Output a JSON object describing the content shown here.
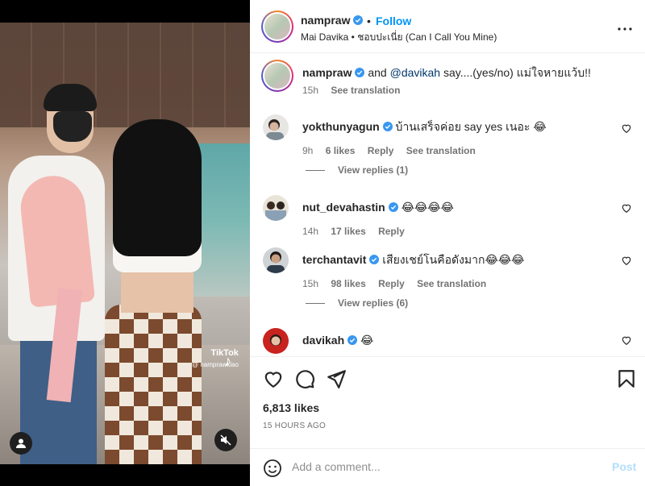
{
  "header": {
    "username": "nampraw",
    "follow_label": "Follow",
    "separator": "•",
    "subtitle": "Mai Davika • ชอบปะเนี่ย (Can I Call You Mine)",
    "more_icon": "more-horizontal-icon"
  },
  "media": {
    "watermark_brand": "TikTok",
    "watermark_handle": "@ namprawklao",
    "user_tag_icon": "user-icon",
    "mute_icon": "muted-speaker-icon"
  },
  "caption": {
    "username": "nampraw",
    "text_prefix": " and ",
    "mention": "@davikah",
    "text_suffix": " say....(yes/no) แม่ใจหายแว้บ!!",
    "time": "15h",
    "translate": "See translation"
  },
  "comments": [
    {
      "username": "yokthunyagun",
      "text": " บ้านเสร็จค่อย say yes เนอะ 😂",
      "time": "9h",
      "likes": "6 likes",
      "reply": "Reply",
      "translate": "See translation",
      "view_replies": "View replies (1)"
    },
    {
      "username": "nut_devahastin",
      "text": " 😂😂😂😂",
      "time": "14h",
      "likes": "17 likes",
      "reply": "Reply"
    },
    {
      "username": "terchantavit",
      "text": " เสียงเชย์โนคือดังมาก😂😂😂",
      "time": "15h",
      "likes": "98 likes",
      "reply": "Reply",
      "translate": "See translation",
      "view_replies": "View replies (6)"
    },
    {
      "username": "davikah",
      "text": " 😂"
    }
  ],
  "footer": {
    "likes": "6,813 likes",
    "time_ago": "15 HOURS AGO",
    "comment_placeholder": "Add a comment...",
    "post_label": "Post"
  },
  "colors": {
    "accent": "#0095f6",
    "verified": "#3897f0",
    "post_disabled": "#b2dffc",
    "muted_text": "#737373"
  }
}
